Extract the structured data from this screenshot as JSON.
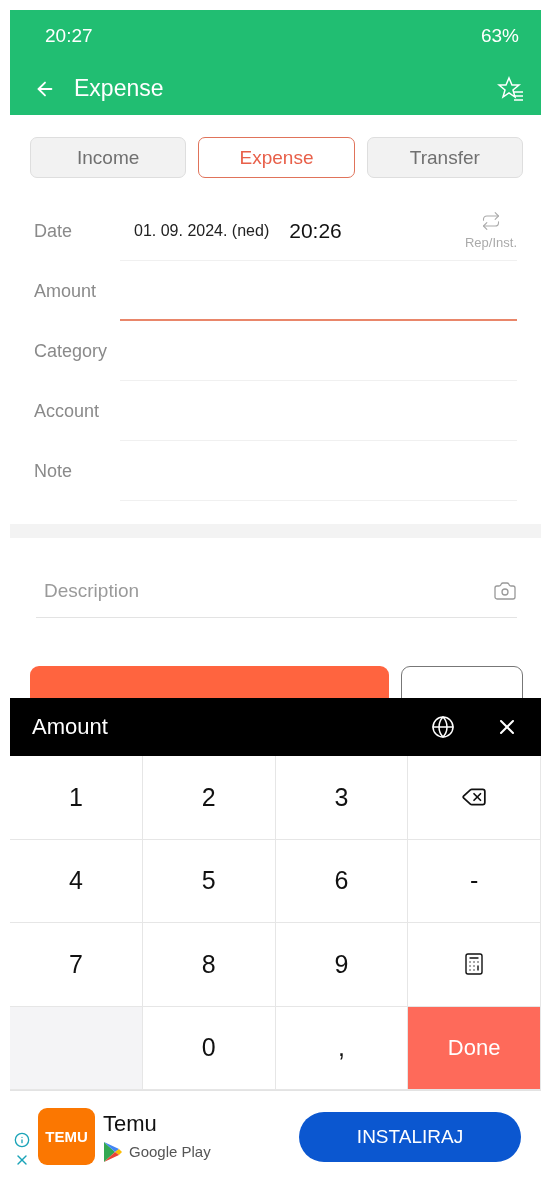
{
  "status_bar": {
    "time": "20:27",
    "battery": "63%"
  },
  "toolbar": {
    "title": "Expense"
  },
  "tabs": [
    {
      "label": "Income",
      "selected": false
    },
    {
      "label": "Expense",
      "selected": true
    },
    {
      "label": "Transfer",
      "selected": false
    }
  ],
  "form": {
    "date_label": "Date",
    "date": "01. 09. 2024. (ned)",
    "time": "20:26",
    "repeat_label": "Rep/Inst.",
    "fields": [
      {
        "label": "Amount",
        "focused": true
      },
      {
        "label": "Category",
        "focused": false
      },
      {
        "label": "Account",
        "focused": false
      },
      {
        "label": "Note",
        "focused": false
      }
    ],
    "description": {
      "placeholder": "Description"
    }
  },
  "keypad": {
    "title": "Amount",
    "keys": [
      {
        "kind": "digit",
        "text": "1"
      },
      {
        "kind": "digit",
        "text": "2"
      },
      {
        "kind": "digit",
        "text": "3"
      },
      {
        "kind": "backspace"
      },
      {
        "kind": "digit",
        "text": "4"
      },
      {
        "kind": "digit",
        "text": "5"
      },
      {
        "kind": "digit",
        "text": "6"
      },
      {
        "kind": "digit",
        "text": "-"
      },
      {
        "kind": "digit",
        "text": "7"
      },
      {
        "kind": "digit",
        "text": "8"
      },
      {
        "kind": "digit",
        "text": "9"
      },
      {
        "kind": "calculator"
      },
      {
        "kind": "empty"
      },
      {
        "kind": "digit",
        "text": "0"
      },
      {
        "kind": "digit",
        "text": ","
      },
      {
        "kind": "done",
        "text": "Done"
      }
    ]
  },
  "ad": {
    "app_name": "Temu",
    "logo_text": "TEMU",
    "store": "Google Play",
    "button": "INSTALIRAJ"
  }
}
